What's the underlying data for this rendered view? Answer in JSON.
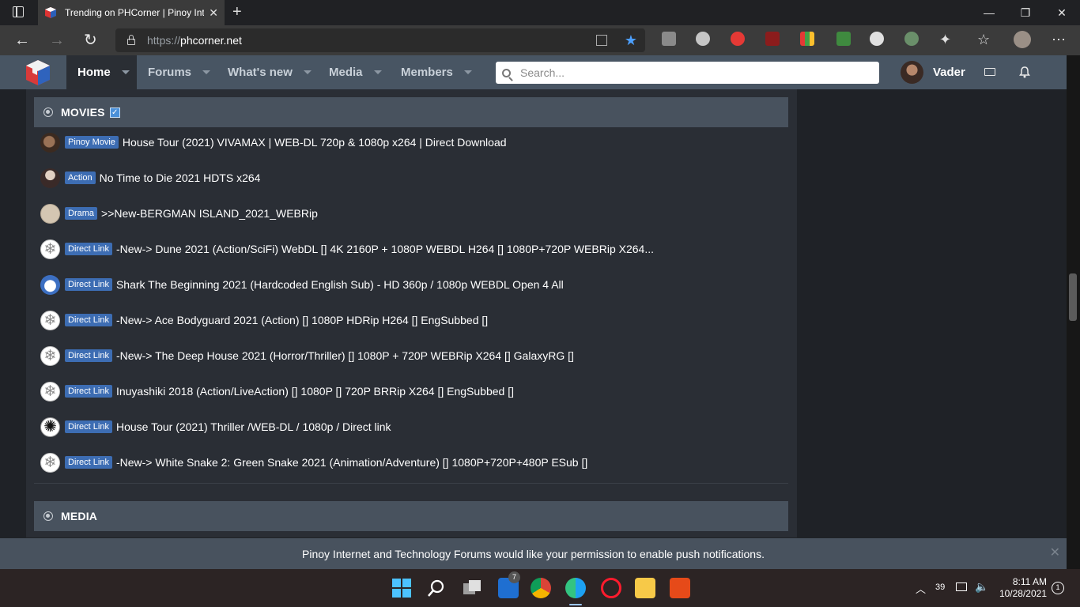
{
  "browser": {
    "tab_title": "Trending on PHCorner | Pinoy Int",
    "url_prefix": "https://",
    "url_domain": "phcorner.net",
    "new_tab": "+",
    "win_minimize": "—",
    "win_restore": "❐",
    "win_close": "✕"
  },
  "site_nav": {
    "items": [
      {
        "label": "Home",
        "active": true
      },
      {
        "label": "Forums"
      },
      {
        "label": "What's new"
      },
      {
        "label": "Media"
      },
      {
        "label": "Members"
      }
    ],
    "search_placeholder": "Search...",
    "username": "Vader"
  },
  "movies_block": {
    "title": "MOVIES",
    "threads": [
      {
        "prefix": "Pinoy Movie",
        "title": "House Tour (2021) VIVAMAX | WEB-DL 720p & 1080p x264 | Direct Download",
        "avatar": "brown"
      },
      {
        "prefix": "Action",
        "title": "No Time to Die 2021 HDTS x264",
        "avatar": "anime"
      },
      {
        "prefix": "Drama",
        "title": ">>New-BERGMAN ISLAND_2021_WEBRip",
        "avatar": "beige"
      },
      {
        "prefix": "Direct Link",
        "title": "-New-> Dune 2021 (Action/SciFi) WebDL [] 4K 2160P + 1080P WEBDL H264 [] 1080P+720P WEBRip X264...",
        "avatar": "snow"
      },
      {
        "prefix": "Direct Link",
        "title": "Shark The Beginning 2021 (Hardcoded English Sub) - HD 360p / 1080p WEBDL Open 4 All",
        "avatar": "blue"
      },
      {
        "prefix": "Direct Link",
        "title": "-New-> Ace Bodyguard 2021 (Action) [] 1080P HDRip H264 [] EngSubbed []",
        "avatar": "snow"
      },
      {
        "prefix": "Direct Link",
        "title": "-New-> The Deep House 2021 (Horror/Thriller) [] 1080P + 720P WEBRip X264 [] GalaxyRG []",
        "avatar": "snow"
      },
      {
        "prefix": "Direct Link",
        "title": "Inuyashiki 2018 (Action/LiveAction) [] 1080P [] 720P BRRip X264 [] EngSubbed []",
        "avatar": "snow"
      },
      {
        "prefix": "Direct Link",
        "title": "House Tour (2021) Thriller /WEB-DL / 1080p / Direct link",
        "avatar": "bw"
      },
      {
        "prefix": "Direct Link",
        "title": "-New-> White Snake 2: Green Snake 2021 (Animation/Adventure) [] 1080P+720P+480P ESub []",
        "avatar": "snow"
      }
    ]
  },
  "media_block": {
    "title": "MEDIA"
  },
  "push_notification": {
    "message": "Pinoy Internet and Technology Forums would like your permission to enable push notifications."
  },
  "taskbar": {
    "tray_weather": "39",
    "time": "8:11 AM",
    "date": "10/28/2021",
    "notification_count": "1",
    "store_badge": "7"
  },
  "colors": {
    "site_nav_bg": "#485563",
    "block_head_bg": "#48525e",
    "prefix_label_bg": "#3d6db3",
    "content_bg": "#2a2e35"
  }
}
